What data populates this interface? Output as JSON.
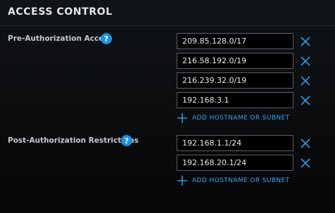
{
  "header": {
    "title": "ACCESS CONTROL"
  },
  "pre_auth": {
    "label": "Pre-Authorization Access",
    "help_icon": "question-circle-icon",
    "entries": [
      "209.85.128.0/17",
      "216.58.192.0/19",
      "216.239.32.0/19",
      "192.168.3.1"
    ],
    "add_label": "ADD HOSTNAME OR SUBNET"
  },
  "post_auth": {
    "label": "Post-Authorization Restrictions",
    "help_icon": "question-circle-icon",
    "entries": [
      "192.168.1.1/24",
      "192.168.20.1/24"
    ],
    "add_label": "ADD HOSTNAME OR SUBNET"
  },
  "colors": {
    "accent": "#1a8fe6",
    "link": "#37a6f0",
    "background": "#050607"
  }
}
